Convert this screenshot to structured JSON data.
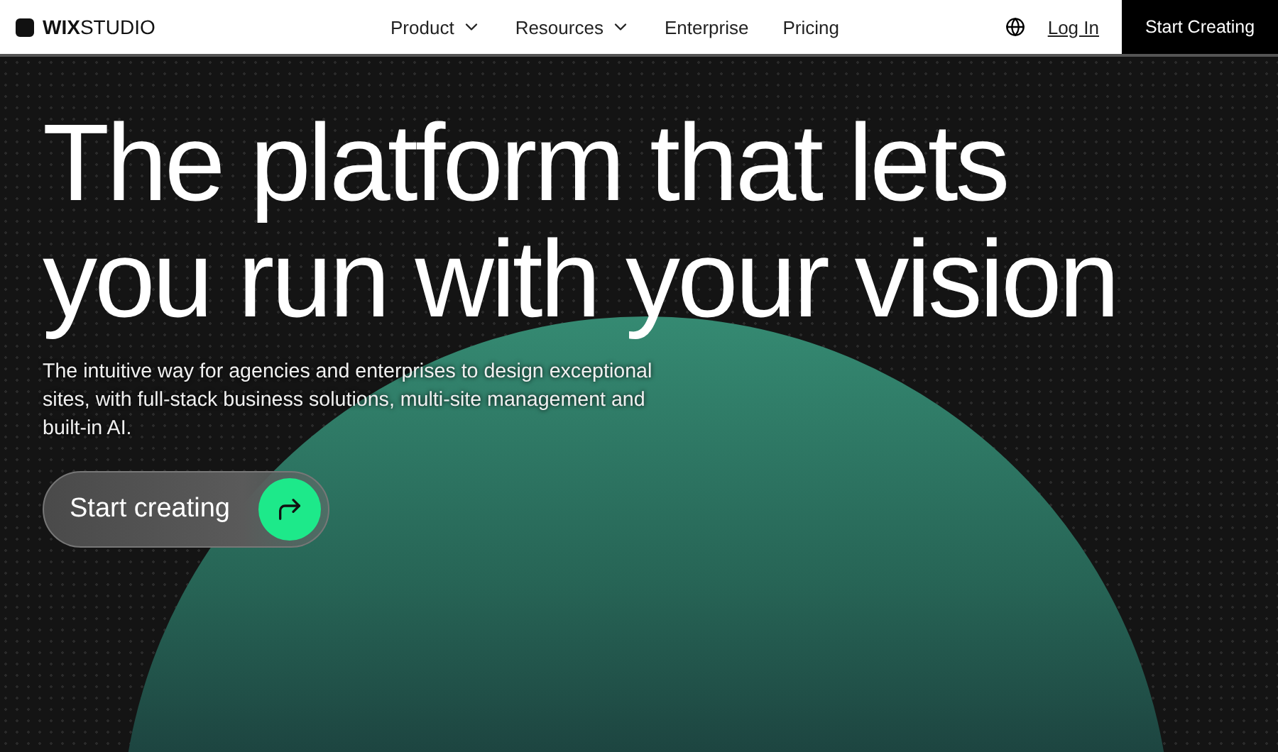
{
  "header": {
    "logo": {
      "bold": "WIX",
      "light": "STUDIO"
    },
    "nav": [
      {
        "label": "Product",
        "dropdown": true
      },
      {
        "label": "Resources",
        "dropdown": true
      },
      {
        "label": "Enterprise",
        "dropdown": false
      },
      {
        "label": "Pricing",
        "dropdown": false
      }
    ],
    "login": "Log In",
    "cta": "Start Creating"
  },
  "hero": {
    "headline": [
      "The platform that lets",
      "you run with your vision"
    ],
    "subtitle": "The intuitive way for agencies and enterprises to design exceptional sites, with full-stack business solutions, multi-site management and built-in AI.",
    "button": "Start creating"
  }
}
